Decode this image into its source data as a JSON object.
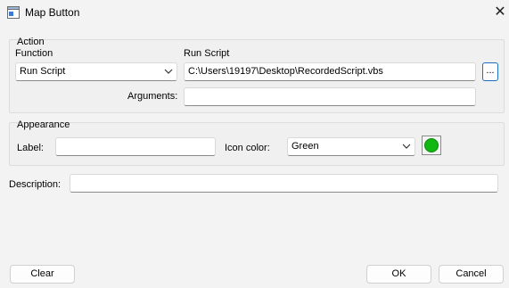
{
  "window": {
    "title": "Map Button",
    "app_icon": "window-icon",
    "close_icon": "close-icon",
    "close_glyph": "✕"
  },
  "action_group": {
    "legend": "Action",
    "function_label": "Function",
    "function_value": "Run Script",
    "run_script_label": "Run Script",
    "run_script_value": "C:\\Users\\19197\\Desktop\\RecordedScript.vbs",
    "browse_label": "...",
    "arguments_label": "Arguments:",
    "arguments_value": ""
  },
  "appearance_group": {
    "legend": "Appearance",
    "label_label": "Label:",
    "label_value": "",
    "icon_color_label": "Icon color:",
    "icon_color_value": "Green",
    "icon_color_hex": "#12b812"
  },
  "description": {
    "label": "Description:",
    "value": ""
  },
  "footer": {
    "clear_label": "Clear",
    "ok_label": "OK",
    "cancel_label": "Cancel"
  },
  "colors": {
    "background": "#f3f3f3",
    "accent": "#1a6fc4"
  }
}
